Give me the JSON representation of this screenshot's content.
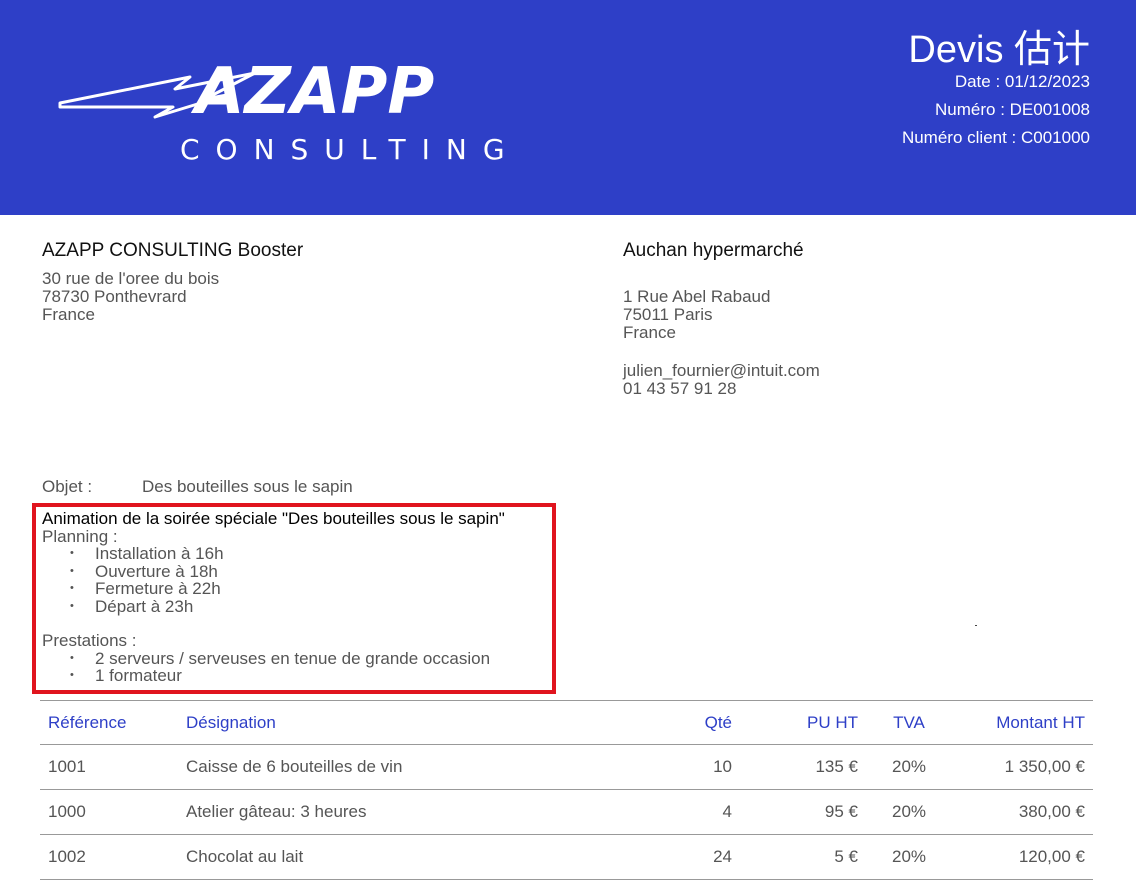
{
  "header": {
    "logo_text": "AZAPP",
    "logo_subtext": "CONSULTING",
    "doc_title": "Devis 估计",
    "date": "Date : 01/12/2023",
    "numero": "Numéro : DE001008",
    "numero_client": "Numéro client : C001000",
    "brand_color": "#2e3fc7"
  },
  "from": {
    "name": "AZAPP CONSULTING Booster",
    "address1": "30 rue de l'oree du bois",
    "address2": "78730 Ponthevrard",
    "country": "France"
  },
  "to": {
    "name": "Auchan hypermarché",
    "address1": "1 Rue Abel Rabaud",
    "address2": "75011 Paris",
    "country": "France",
    "email": "julien_fournier@intuit.com",
    "phone": "01 43 57 91 28"
  },
  "objet": {
    "label": "Objet :",
    "value": "Des bouteilles sous le sapin"
  },
  "description": {
    "title": "Animation de la soirée spéciale \"Des bouteilles sous le sapin\"",
    "planning_label": "Planning :",
    "planning": [
      "Installation à 16h",
      "Ouverture à 18h",
      "Fermeture à 22h",
      "Départ à 23h"
    ],
    "prestations_label": "Prestations :",
    "prestations": [
      "2 serveurs / serveuses en tenue de grande occasion",
      "1 formateur"
    ],
    "highlight_color": "#e0141e"
  },
  "table": {
    "headers": [
      "Référence",
      "Désignation",
      "Qté",
      "PU HT",
      "TVA",
      "Montant HT"
    ],
    "rows": [
      [
        "1001",
        "Caisse de 6 bouteilles de vin",
        "10",
        "135 €",
        "20%",
        "1 350,00 €"
      ],
      [
        "1000",
        "Atelier gâteau: 3 heures",
        "4",
        "95 €",
        "20%",
        "380,00 €"
      ],
      [
        "1002",
        "Chocolat au lait",
        "24",
        "5 €",
        "20%",
        "120,00 €"
      ]
    ]
  }
}
